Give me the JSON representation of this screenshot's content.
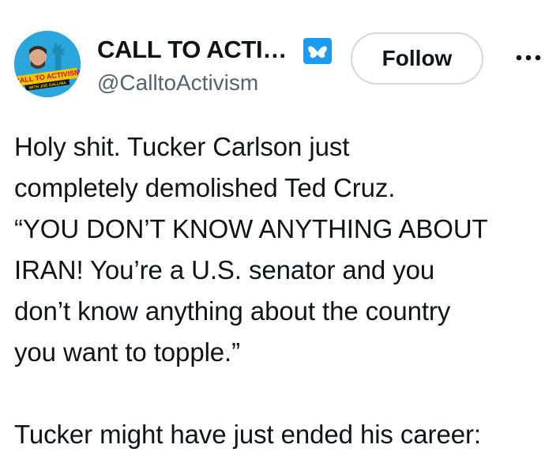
{
  "author": {
    "display_name": "CALL TO ACTI…",
    "handle": "@CalltoActivism",
    "avatar_text_top": "CALL TO ACTIVISM",
    "avatar_text_bottom": "WITH JOE GALLINA",
    "verified_icon": "bluesky-butterfly-verified-icon"
  },
  "actions": {
    "follow_label": "Follow",
    "more_icon": "more-horizontal-icon"
  },
  "tweet": {
    "text": "Holy shit. Tucker Carlson just\ncompletely demolished Ted Cruz.\n“YOU DON’T KNOW ANYTHING ABOUT\nIRAN! You’re a U.S. senator and you\ndon’t know anything about the country\nyou want to topple.”\n\nTucker might have just ended his career:"
  },
  "colors": {
    "text_primary": "#0f1419",
    "text_secondary": "#536471",
    "verified_blue": "#1d9bf0",
    "button_border": "#cfd9de",
    "avatar_bg": "#2aa6dc"
  }
}
